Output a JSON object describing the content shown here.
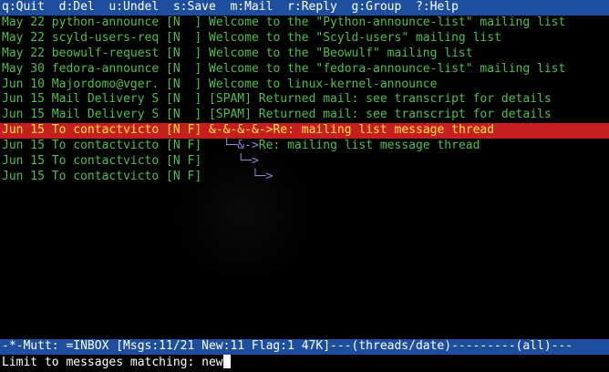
{
  "help": {
    "text": "q:Quit  d:Del  u:Undel  s:Save  m:Mail  r:Reply  g:Group  ?:Help"
  },
  "messages": [
    {
      "date": "May 22",
      "from": "python-announce",
      "flags": "[N  ]",
      "tree": "",
      "subject": "Welcome to the \"Python-announce-list\" mailing list"
    },
    {
      "date": "May 22",
      "from": "scyld-users-req",
      "flags": "[N  ]",
      "tree": "",
      "subject": "Welcome to the \"Scyld-users\" mailing list"
    },
    {
      "date": "May 22",
      "from": "beowulf-request",
      "flags": "[N  ]",
      "tree": "",
      "subject": "Welcome to the \"Beowulf\" mailing list"
    },
    {
      "date": "May 30",
      "from": "fedora-announce",
      "flags": "[N  ]",
      "tree": "",
      "subject": "Welcome to the \"fedora-announce-list\" mailing list"
    },
    {
      "date": "Jun 10",
      "from": "Majordomo@vger.",
      "flags": "[N  ]",
      "tree": "",
      "subject": "Welcome to linux-kernel-announce"
    },
    {
      "date": "Jun 15",
      "from": "Mail Delivery S",
      "flags": "[N  ]",
      "tree": "",
      "subject": "[SPAM] Returned mail: see transcript for details"
    },
    {
      "date": "Jun 15",
      "from": "Mail Delivery S",
      "flags": "[N  ]",
      "tree": "",
      "subject": "[SPAM] Returned mail: see transcript for details"
    },
    {
      "date": "Jun 15",
      "from": "To contactvicto",
      "flags": "[N F]",
      "tree": "&-&-&-&->",
      "subject": "Re: mailing list message thread"
    },
    {
      "date": "Jun 15",
      "from": "To contactvicto",
      "flags": "[N F]",
      "tree": "  └─&->",
      "subject": "Re: mailing list message thread"
    },
    {
      "date": "Jun 15",
      "from": "To contactvicto",
      "flags": "[N F]",
      "tree": "    └─>",
      "subject": ""
    },
    {
      "date": "Jun 15",
      "from": "To contactvicto",
      "flags": "[N F]",
      "tree": "      └─>",
      "subject": ""
    }
  ],
  "status": {
    "text": "-*-Mutt: =INBOX [Msgs:11/21 New:11 Flag:1 47K]---(threads/date)---------(all)---"
  },
  "prompt": {
    "label": "Limit to messages matching: ",
    "value": "new"
  },
  "colors": {
    "bar": "#1e4f9e",
    "message_text": "#4fbf4f",
    "selected_bg": "#c71f1f",
    "selected_text": "#ffe54a"
  }
}
